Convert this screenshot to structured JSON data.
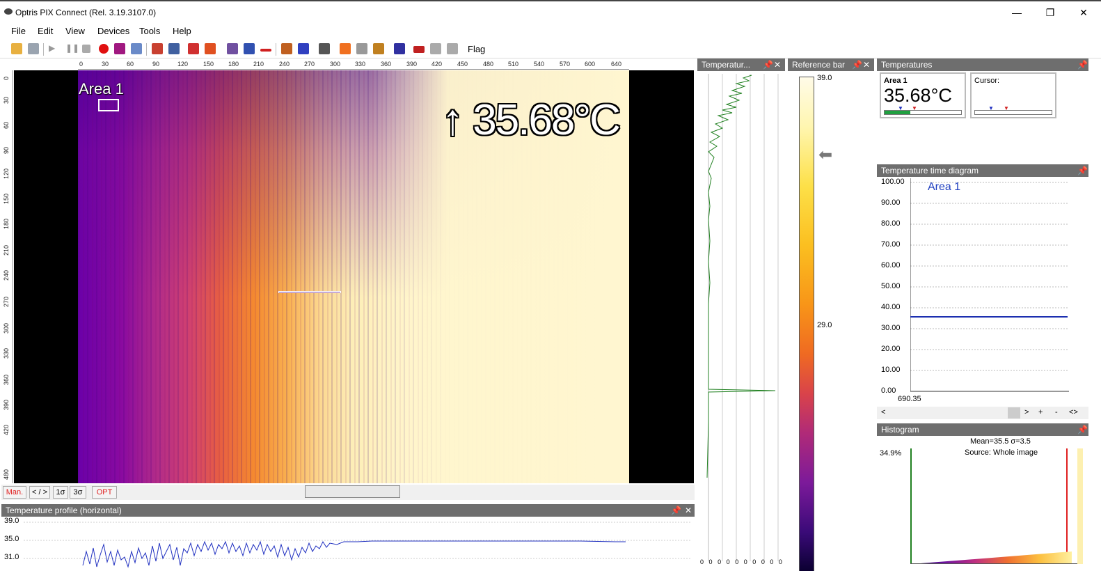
{
  "window": {
    "title": "Optris PIX Connect (Rel. 3.19.3107.0)",
    "minimize": "—",
    "maximize": "❐",
    "close": "✕"
  },
  "menu": [
    "File",
    "Edit",
    "View",
    "Devices",
    "Tools",
    "Help"
  ],
  "toolbar": {
    "flag_label": "Flag"
  },
  "image": {
    "area_label": "Area 1",
    "big_temperature": "↑ 35.68°C",
    "ruler_top": [
      "0",
      "30",
      "60",
      "90",
      "120",
      "150",
      "180",
      "210",
      "240",
      "270",
      "300",
      "330",
      "360",
      "390",
      "420",
      "450",
      "480",
      "510",
      "540",
      "570",
      "600",
      "640"
    ],
    "ruler_left": [
      "0",
      "30",
      "60",
      "90",
      "120",
      "150",
      "180",
      "210",
      "240",
      "270",
      "300",
      "330",
      "360",
      "390",
      "420",
      "480"
    ]
  },
  "controls": {
    "man": "Man.",
    "range": "< / >",
    "sigma1": "1σ",
    "sigma3": "3σ",
    "opt": "OPT"
  },
  "profile_h": {
    "title": "Temperature profile (horizontal)",
    "yticks": [
      "39.0",
      "35.0",
      "31.0"
    ]
  },
  "profile_v": {
    "title": "Temperatur...",
    "xticks": [
      "0",
      "0",
      "0",
      "0",
      "0",
      "0",
      "0",
      "0",
      "0",
      "0"
    ]
  },
  "reference_bar": {
    "title": "Reference bar",
    "max": "39.0",
    "mid": "29.0",
    "pointer": "⬅",
    "colors": {
      "top": "#fffbe8",
      "bottom": "#0a0030"
    }
  },
  "temperatures": {
    "title": "Temperatures",
    "area": {
      "label": "Area 1",
      "value": "35.68°C"
    },
    "cursor": {
      "label": "Cursor:"
    }
  },
  "time_diagram": {
    "title": "Temperature time diagram",
    "legend": "Area 1",
    "x_label": "690.35",
    "nav": [
      "<",
      ">",
      "+",
      "-",
      "<>"
    ],
    "chart_data": {
      "type": "line",
      "yticks": [
        "100.00",
        "90.00",
        "80.00",
        "70.00",
        "60.00",
        "50.00",
        "40.00",
        "30.00",
        "20.00",
        "10.00",
        "0.00"
      ],
      "ylim": [
        0,
        100
      ],
      "series": [
        {
          "name": "Area 1",
          "values": [
            35.68,
            35.68
          ]
        }
      ],
      "colors": {
        "line": "#1c2fb0"
      }
    }
  },
  "histogram": {
    "title": "Histogram",
    "stats": "Mean=35.5 σ=3.5",
    "source": "Source:  Whole image",
    "peak": "34.9%"
  },
  "icons": [
    "camera-icon",
    "record-icon",
    "play-icon",
    "pause-icon",
    "stop-icon",
    "open-folder-icon",
    "save-icon"
  ]
}
